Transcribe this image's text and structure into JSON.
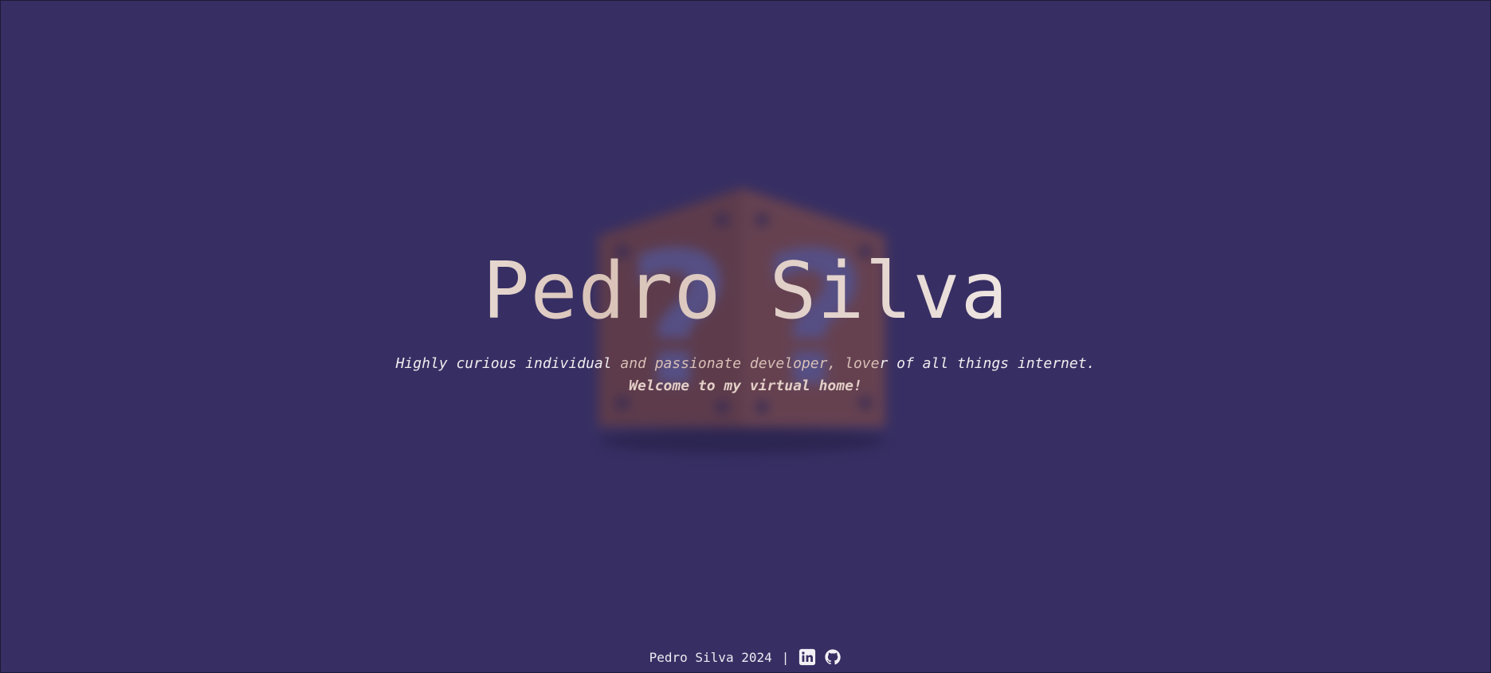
{
  "hero": {
    "title": "Pedro Silva",
    "tagline_part1": "Highly curious individual ",
    "tagline_part2": "and passionate developer, love",
    "tagline_part3": "r of all things internet.",
    "welcome": "Welcome to my virtual home!"
  },
  "footer": {
    "copyright": "Pedro Silva 2024",
    "separator": "|",
    "links": [
      {
        "icon": "linkedin-icon"
      },
      {
        "icon": "github-icon"
      }
    ]
  },
  "colors": {
    "background": "#372f63",
    "text": "#f1ecef",
    "accent_warm": "#d8bfb6",
    "block_brown": "#8a4a3a"
  }
}
